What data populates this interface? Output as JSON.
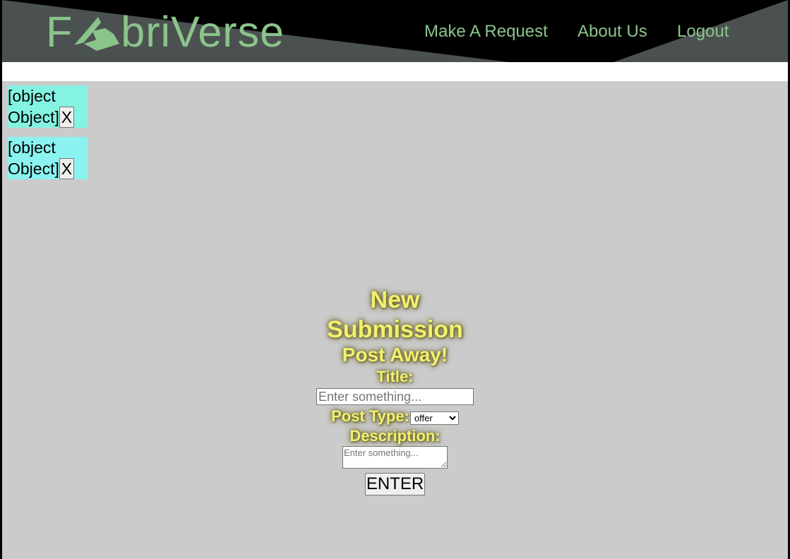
{
  "header": {
    "logo": {
      "first_letter": "F",
      "rest": "briVerse"
    },
    "nav": {
      "request": "Make A Request",
      "about": "About Us",
      "logout": "Logout"
    }
  },
  "items": [
    {
      "line1": "[object",
      "line2": "Object]",
      "remove": "X"
    },
    {
      "line1": "[object",
      "line2": "Object]",
      "remove": "X"
    }
  ],
  "form": {
    "heading": "New Submission",
    "subheading": "Post Away!",
    "title_label": "Title:",
    "title_placeholder": "Enter something...",
    "post_type_label": "Post Type:",
    "post_type_value": "offer",
    "description_label": "Description:",
    "description_placeholder": "Enter something...",
    "submit": "ENTER"
  },
  "colors": {
    "accent_green": "#8bc48a",
    "item_bg": "#84f3e4",
    "heading_yellow": "#f2f06f",
    "panel_gray": "#cbcbcb"
  }
}
